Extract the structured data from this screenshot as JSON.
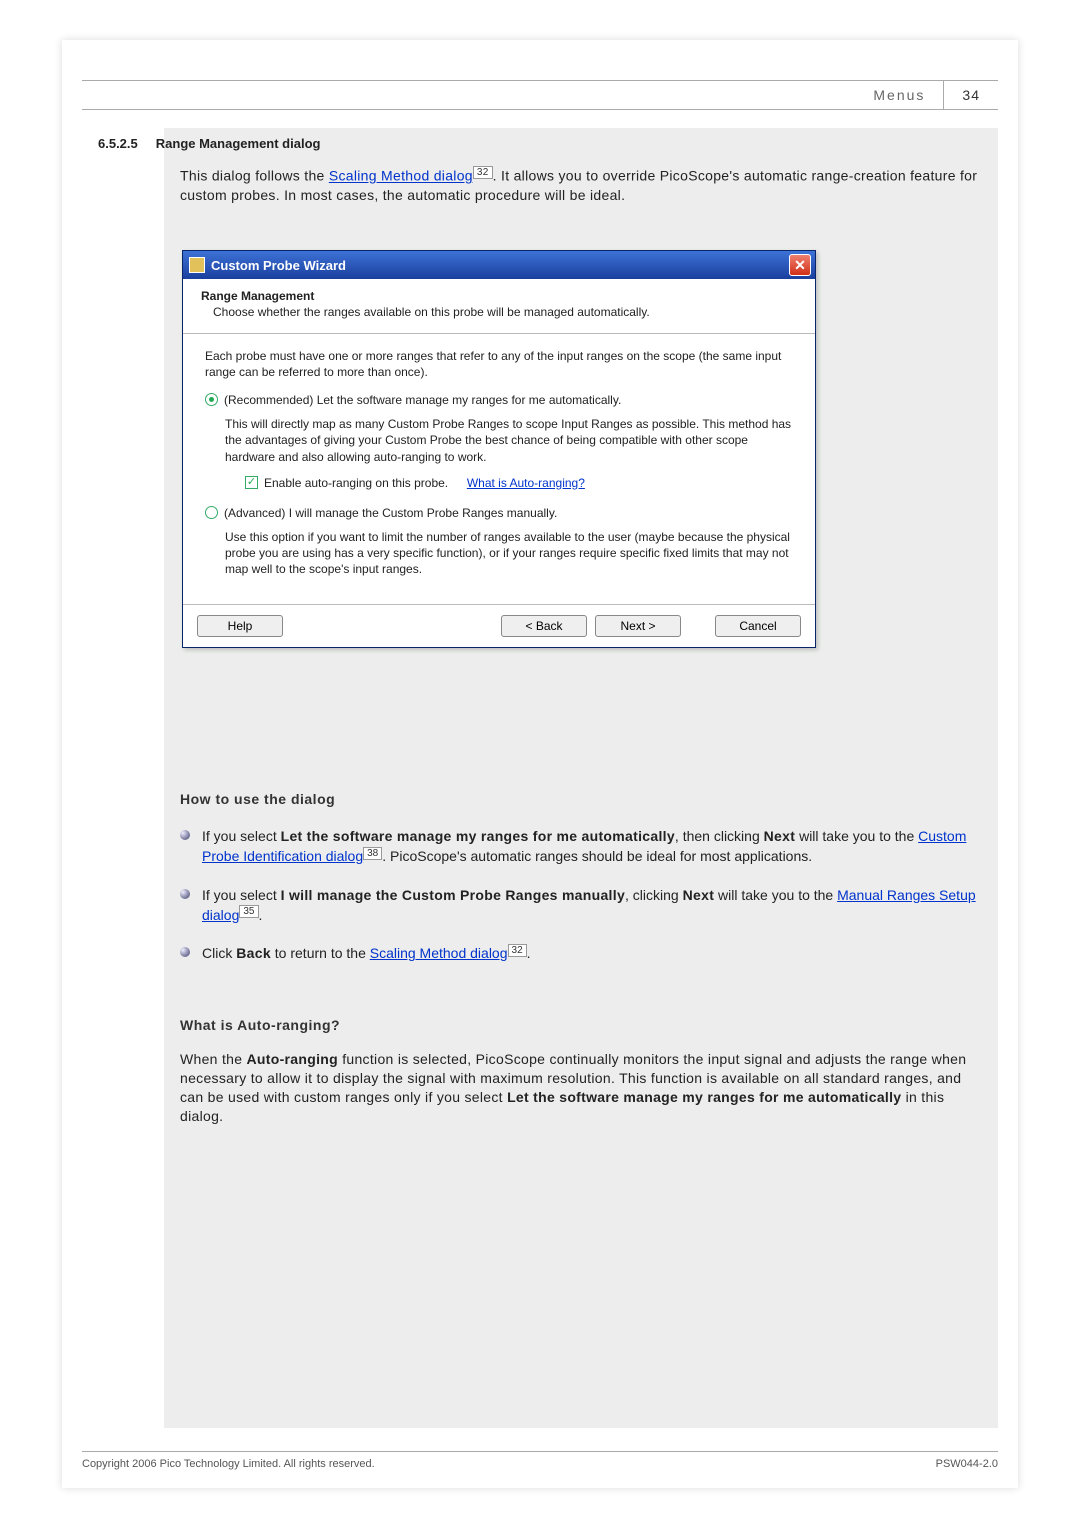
{
  "header": {
    "section_label": "Menus",
    "page_number": "34"
  },
  "section": {
    "number": "6.5.2.5",
    "title": "Range Management dialog"
  },
  "intro": {
    "pre": "This dialog follows the ",
    "link": "Scaling Method dialog",
    "ref": "32",
    "post": ". It allows you to override PicoScope's automatic range-creation feature for custom probes. In most cases, the automatic procedure will be ideal."
  },
  "wizard": {
    "title": "Custom Probe Wizard",
    "head_title": "Range Management",
    "head_sub": "Choose whether the ranges available on this probe will be managed automatically.",
    "intro_text": "Each probe must have one or more ranges that refer to any of the input ranges on the scope (the same input range can be referred to more than once).",
    "opt_auto_label": "(Recommended) Let the software manage my ranges for me automatically.",
    "opt_auto_desc": "This will directly map as many Custom Probe Ranges to scope Input Ranges as possible. This method has the advantages of giving your Custom Probe the best chance of being compatible with other scope hardware and also allowing auto-ranging to work.",
    "checkbox_label": "Enable auto-ranging on this probe.",
    "checkbox_link": "What is Auto-ranging?",
    "opt_manual_label": "(Advanced) I will manage the Custom Probe Ranges manually.",
    "opt_manual_desc": "Use this option if you want to limit the number of ranges available to the user (maybe because the physical probe you are using has a very specific function), or if your ranges require specific fixed limits that may not map well to the scope's input ranges.",
    "buttons": {
      "help": "Help",
      "back": "< Back",
      "next": "Next >",
      "cancel": "Cancel"
    }
  },
  "howto": {
    "heading": "How to use the dialog",
    "b1_pre": "If you select ",
    "b1_bold": "Let the software manage my ranges for me automatically",
    "b1_mid1": ", then clicking ",
    "b1_bold2": "Next",
    "b1_mid2": " will take you to the ",
    "b1_link": "Custom Probe Identification dialog",
    "b1_ref": "38",
    "b1_post": ". PicoScope's automatic ranges should be ideal for most applications.",
    "b2_pre": "If you select ",
    "b2_bold": "I will manage the Custom Probe Ranges manually",
    "b2_mid1": ", clicking ",
    "b2_bold2": "Next",
    "b2_mid2": " will take you to the ",
    "b2_link": "Manual Ranges Setup dialog",
    "b2_ref": "35",
    "b2_post": ".",
    "b3_pre": "Click ",
    "b3_bold": "Back",
    "b3_mid": " to return to the ",
    "b3_link": "Scaling Method dialog",
    "b3_ref": "32",
    "b3_post": "."
  },
  "whatis": {
    "heading": "What is Auto-ranging?",
    "pre": "When the ",
    "bold1": "Auto-ranging",
    "mid1": " function is selected, PicoScope continually monitors the input signal and adjusts the range when necessary to allow it to display the signal with maximum resolution. This function is available on all standard ranges, and can be used with custom ranges only if you select ",
    "bold2": "Let the software manage my ranges for me automatically",
    "post": " in this dialog."
  },
  "footer": {
    "copyright": "Copyright 2006 Pico Technology Limited. All rights reserved.",
    "doc_id": "PSW044-2.0"
  }
}
